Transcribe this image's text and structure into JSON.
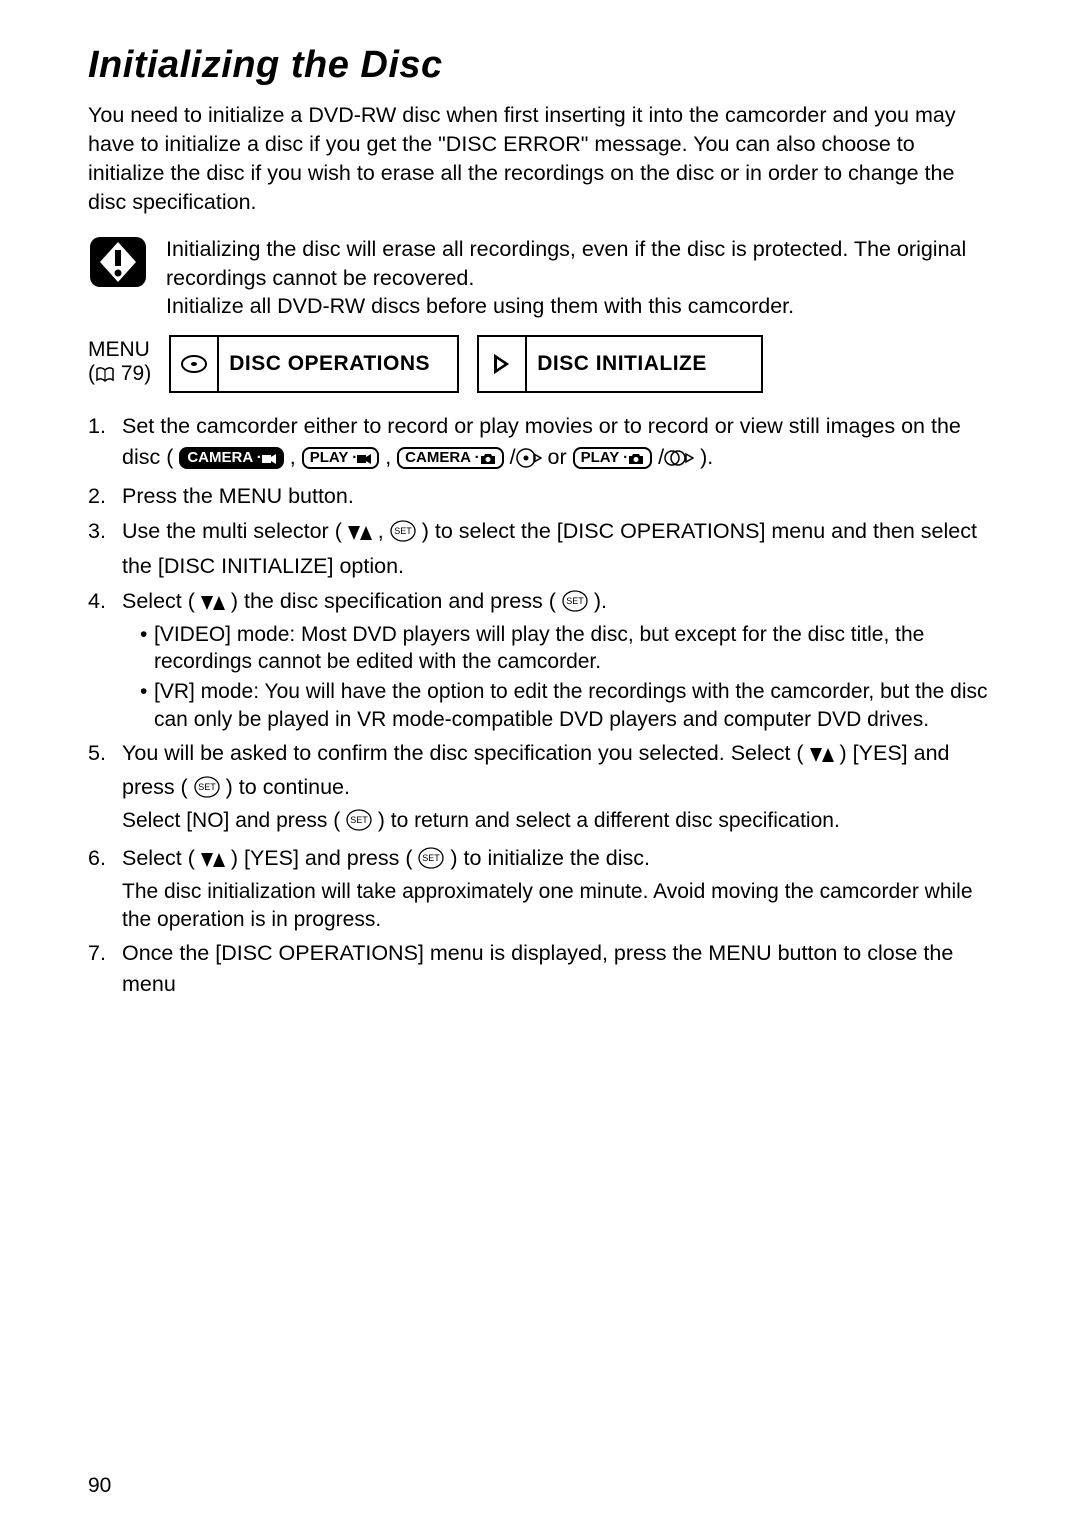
{
  "title": "Initializing the Disc",
  "intro": "You need to initialize a DVD-RW disc when first inserting it into the camcorder and you may have to initialize a disc if you get the \"DISC ERROR\" message. You can also choose to initialize the disc if you wish to erase all the recordings on the disc or in order to change the disc specification.",
  "warning": {
    "line1": "Initializing the disc will erase all recordings, even if the disc is protected. The original recordings cannot be recovered.",
    "line2": "Initialize all DVD-RW discs before using them with this camcorder."
  },
  "menu": {
    "label": "MENU",
    "pageref": "79",
    "box1": "DISC OPERATIONS",
    "box2": "DISC INITIALIZE"
  },
  "steps": {
    "s1a": "Set the camcorder either to record or play movies or to record or view still images on the disc ( ",
    "s1_or": " or ",
    "s1_end": ").",
    "s2": "Press the MENU button.",
    "s3": "Use the multi selector ( ",
    "s3b": " ) to select the [DISC OPERATIONS] menu and then select the [DISC INITIALIZE] option.",
    "s4": "Select ( ",
    "s4b": " ) the disc specification and press ( ",
    "s4c": " ).",
    "s4_sub1": "[VIDEO] mode: Most DVD players will play the disc, but except for the disc title, the recordings cannot be edited with the camcorder.",
    "s4_sub2": "[VR] mode: You will have the option to edit the recordings with the camcorder, but the disc can only be played in VR mode-compatible DVD players and computer DVD drives.",
    "s5a": "You will be asked to confirm the disc specification you selected. Select ( ",
    "s5b": " ) [YES] and press ( ",
    "s5c": " ) to continue.",
    "s5_sub": "Select [NO] and press ( ",
    "s5_sub_b": " ) to return and select a different disc specification.",
    "s6a": "Select ( ",
    "s6b": " ) [YES] and press ( ",
    "s6c": " ) to initialize the disc.",
    "s6_sub": "The disc initialization will take approximately one minute. Avoid moving the camcorder while the operation is in progress.",
    "s7": "Once the [DISC OPERATIONS] menu is displayed, press the MENU button to close the menu"
  },
  "mode_badges": {
    "camera_movie": "CAMERA ·",
    "play_movie": "PLAY ·",
    "camera_photo": "CAMERA ·",
    "play_photo": "PLAY ·"
  },
  "pagenum": "90"
}
